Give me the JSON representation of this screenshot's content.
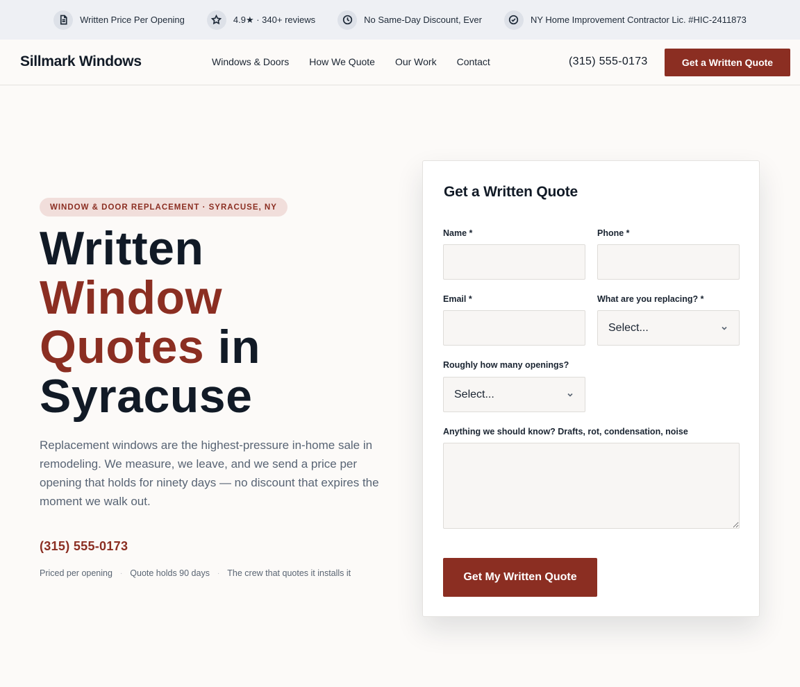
{
  "trust_bar": [
    {
      "icon": "document-icon",
      "label": "Written Price Per Opening"
    },
    {
      "icon": "star-icon",
      "label": "4.9★ · 340+ reviews"
    },
    {
      "icon": "clock-icon",
      "label": "No Same-Day Discount, Ever"
    },
    {
      "icon": "check-circle-icon",
      "label": "NY Home Improvement Contractor Lic. #HIC-2411873"
    }
  ],
  "nav": {
    "logo": "Sillmark Windows",
    "links": [
      "Windows & Doors",
      "How We Quote",
      "Our Work",
      "Contact"
    ],
    "phone": "(315) 555-0173",
    "cta": "Get a Written Quote"
  },
  "hero": {
    "eyebrow": "WINDOW & DOOR REPLACEMENT · SYRACUSE, NY",
    "headline": {
      "line1": "Written",
      "line2_accent": "Window",
      "line3_accent": "Quotes",
      "line3_rest": " in",
      "line4": "Syracuse"
    },
    "lede": "Replacement windows are the highest-pressure in-home sale in remodeling. We measure, we leave, and we send a price per opening that holds for ninety days — no discount that expires the moment we walk out.",
    "phone": "(315) 555-0173",
    "facts": [
      "Priced per opening",
      "Quote holds 90 days",
      "The crew that quotes it installs it"
    ],
    "fact_separator": "·"
  },
  "form": {
    "title": "Get a Written Quote",
    "name_label": "Name *",
    "name_value": "",
    "phone_label": "Phone *",
    "phone_value": "",
    "email_label": "Email *",
    "email_value": "",
    "replacing_label": "What are you replacing? *",
    "replacing_selected": "Select...",
    "openings_label": "Roughly how many openings?",
    "openings_selected": "Select...",
    "notes_label": "Anything we should know? Drafts, rot, condensation, noise",
    "notes_value": "",
    "submit": "Get My Written Quote"
  },
  "colors": {
    "brand": "#8b2e22",
    "ink": "#111a26",
    "muted": "#586474",
    "trust_bg": "#eef0f4",
    "page_bg": "#fcfaf8"
  }
}
